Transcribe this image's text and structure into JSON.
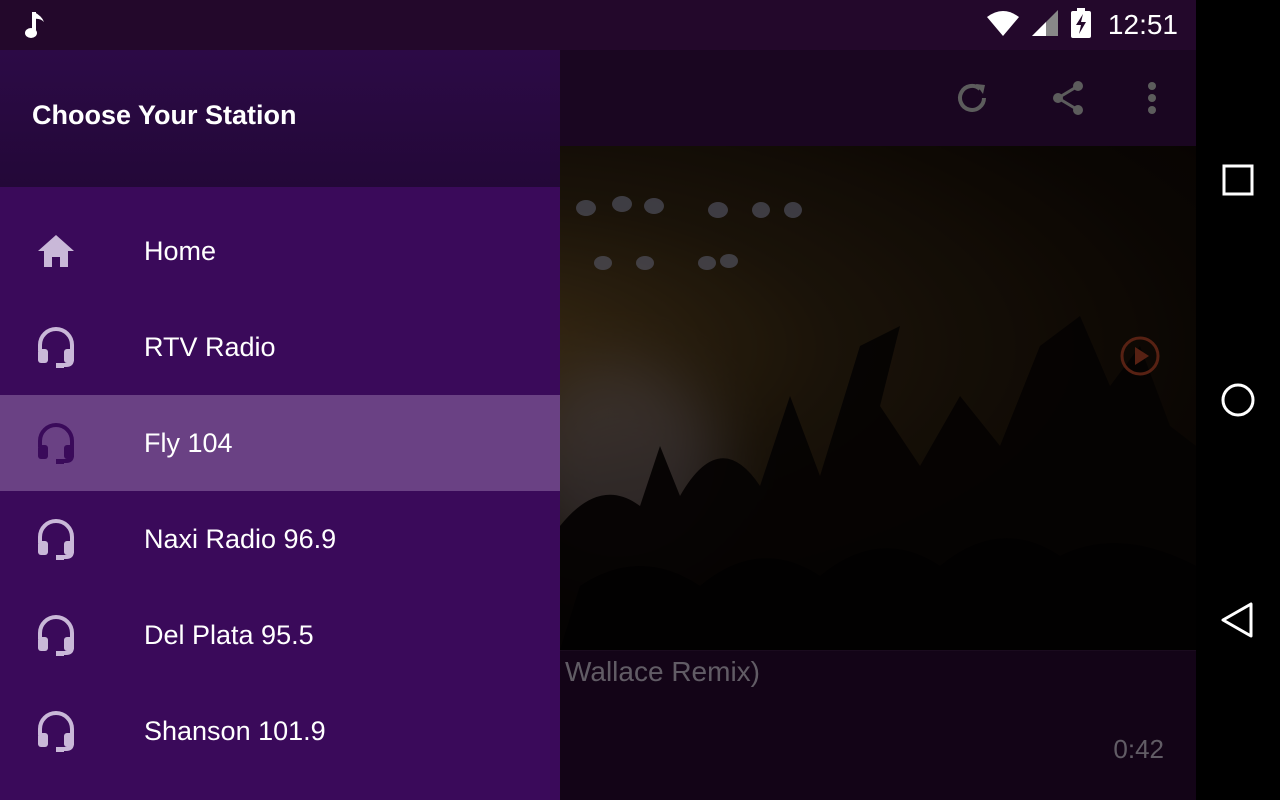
{
  "status": {
    "time": "12:51"
  },
  "drawer": {
    "title": "Choose Your Station",
    "items": [
      {
        "label": "Home",
        "icon": "home-icon"
      },
      {
        "label": "RTV Radio",
        "icon": "headphones-icon"
      },
      {
        "label": "Fly 104",
        "icon": "headphones-icon"
      },
      {
        "label": "Naxi Radio 96.9",
        "icon": "headphones-icon"
      },
      {
        "label": "Del Plata 95.5",
        "icon": "headphones-icon"
      },
      {
        "label": "Shanson 101.9",
        "icon": "headphones-icon"
      }
    ],
    "active_index": 2
  },
  "player": {
    "track_title": "Wallace Remix)",
    "elapsed": "0:42"
  },
  "colors": {
    "drawer_bg": "#3a0a5a",
    "active_item": "#6a4184",
    "accent_play": "#c0492a"
  }
}
